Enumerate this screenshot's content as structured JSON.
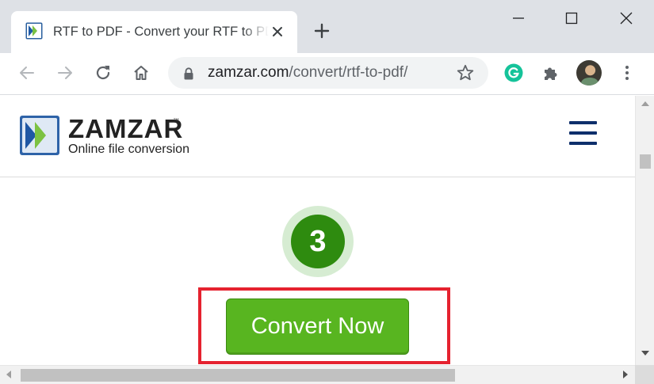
{
  "browser": {
    "tab": {
      "title": "RTF to PDF - Convert your RTF to PDF for Free Online"
    },
    "address_bar": {
      "host": "zamzar.com",
      "path": "/convert/rtf-to-pdf/"
    }
  },
  "site": {
    "logo": {
      "wordmark": "ZAMZAR",
      "trademark": "™",
      "tagline": "Online file conversion"
    }
  },
  "main": {
    "step_number": "3",
    "convert_button_label": "Convert Now"
  },
  "colors": {
    "step_circle": "#2e8b0f",
    "convert_button": "#58b520",
    "highlight_box": "#e5222f",
    "nav_menu": "#0e2f6b",
    "grammarly": "#15c39a"
  },
  "icons": [
    "zamzar-favicon",
    "close-icon",
    "new-tab-icon",
    "minimize-icon",
    "maximize-icon",
    "window-close-icon",
    "back-icon",
    "forward-icon",
    "reload-icon",
    "home-icon",
    "lock-icon",
    "bookmark-star-icon",
    "grammarly-icon",
    "extensions-icon",
    "more-menu-icon",
    "hamburger-menu-icon"
  ]
}
